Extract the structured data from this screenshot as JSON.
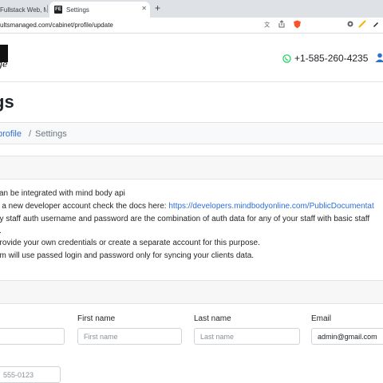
{
  "browser": {
    "inactive_tab_title": "Fullstack Web, Mo",
    "active_tab_title": "Settings",
    "favicon_text": "FE",
    "close_glyph": "✕",
    "new_tab_glyph": "+",
    "url": "ultsmanaged.com/cabinet/profile/update",
    "toolbar_icons": [
      "translate-icon",
      "share-icon",
      "brave-shield-icon",
      "extensions-icon",
      "bookmark-icon",
      "edit-icon"
    ]
  },
  "header": {
    "logo_script": "ge",
    "phone": "+1-585-260-4235",
    "phone_icon": "whatsapp-icon",
    "user_icon": "user-icon"
  },
  "page": {
    "title": "gs"
  },
  "breadcrumb": {
    "link": "profile",
    "separator": "/",
    "current": "Settings"
  },
  "info": {
    "line1": "can be integrated with mind body api",
    "line2_text": "e a new developer account check the docs here: ",
    "line2_link": "https://developers.mindbodyonline.com/PublicDocumentat",
    "line3": "dy staff auth username and password are the combination of auth data for any of your staff with basic staff",
    "line4": "s.",
    "line5": "provide your own credentials or create a separate account for this purpose.",
    "line6": "em will use passed login and password only for syncing your clients data."
  },
  "form": {
    "first_name_label": "First name",
    "first_name_placeholder": "First name",
    "last_name_label": "Last name",
    "last_name_placeholder": "Last name",
    "email_label": "Email",
    "email_value": "admin@gmail.com",
    "phone_placeholder": "555-0123"
  },
  "colors": {
    "link": "#2f6fd6",
    "whatsapp": "#25d366",
    "user_icon": "#2f6fd6"
  }
}
